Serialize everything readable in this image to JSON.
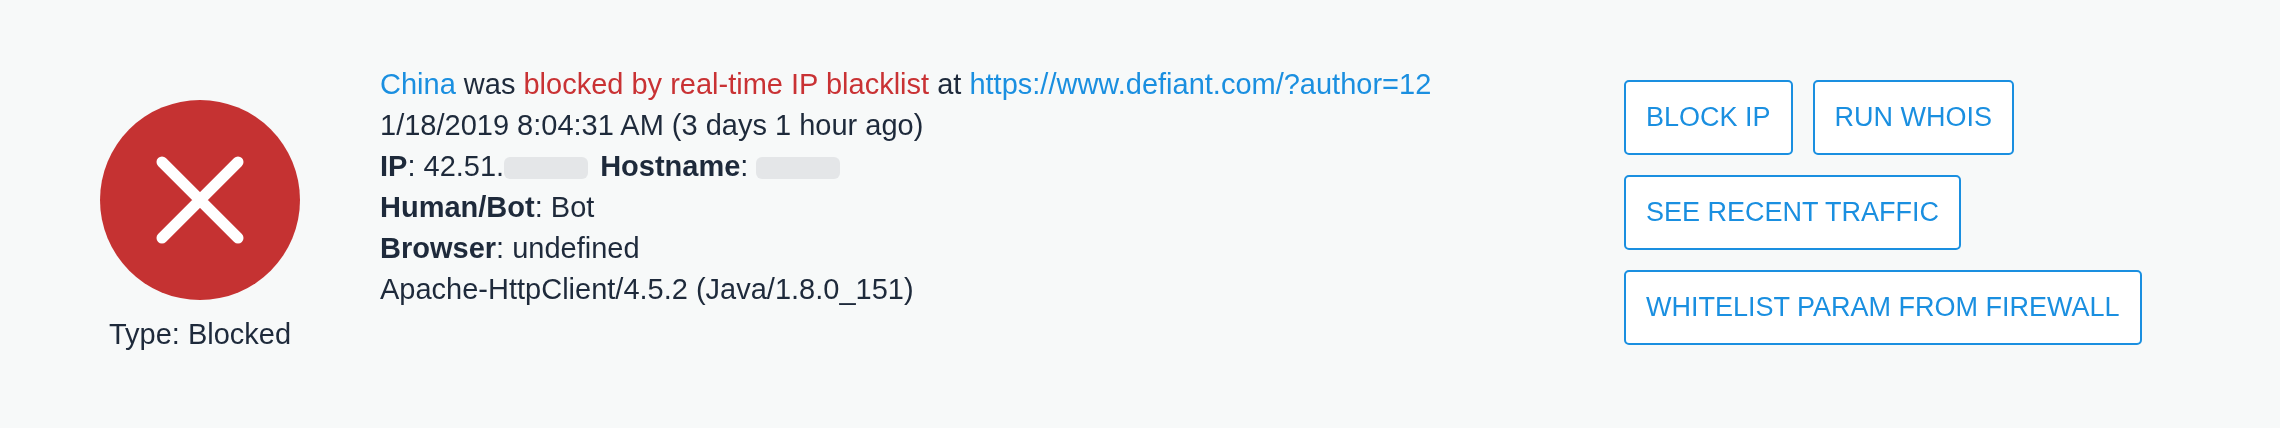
{
  "status": {
    "kind": "blocked",
    "type_label": "Type: Blocked"
  },
  "details": [
    [
      {
        "text": "China",
        "kind": "link"
      },
      {
        "text": " was ",
        "kind": "plain"
      },
      {
        "text": "blocked by real-time IP blacklist",
        "kind": "alert"
      },
      {
        "text": " at ",
        "kind": "plain"
      },
      {
        "text": "https://www.defiant.com/?author=12",
        "kind": "link"
      }
    ],
    [
      {
        "text": "1/18/2019 8:04:31 AM (3 days 1 hour ago)",
        "kind": "plain"
      }
    ],
    [
      {
        "text": "IP",
        "kind": "label"
      },
      {
        "text": ": 42.51.",
        "kind": "plain"
      },
      {
        "kind": "redacted"
      },
      {
        "text": "Hostname",
        "kind": "label"
      },
      {
        "text": ": ",
        "kind": "plain"
      },
      {
        "kind": "redacted"
      }
    ],
    [
      {
        "text": "Human/Bot",
        "kind": "label"
      },
      {
        "text": ": Bot",
        "kind": "plain"
      }
    ],
    [
      {
        "text": "Browser",
        "kind": "label"
      },
      {
        "text": ": undefined",
        "kind": "plain"
      }
    ],
    [
      {
        "text": "Apache-HttpClient/4.5.2 (Java/1.8.0_151)",
        "kind": "plain"
      }
    ]
  ],
  "actions": [
    [
      "BLOCK IP",
      "RUN WHOIS"
    ],
    [
      "SEE RECENT TRAFFIC"
    ],
    [
      "WHITELIST PARAM FROM FIREWALL"
    ]
  ]
}
